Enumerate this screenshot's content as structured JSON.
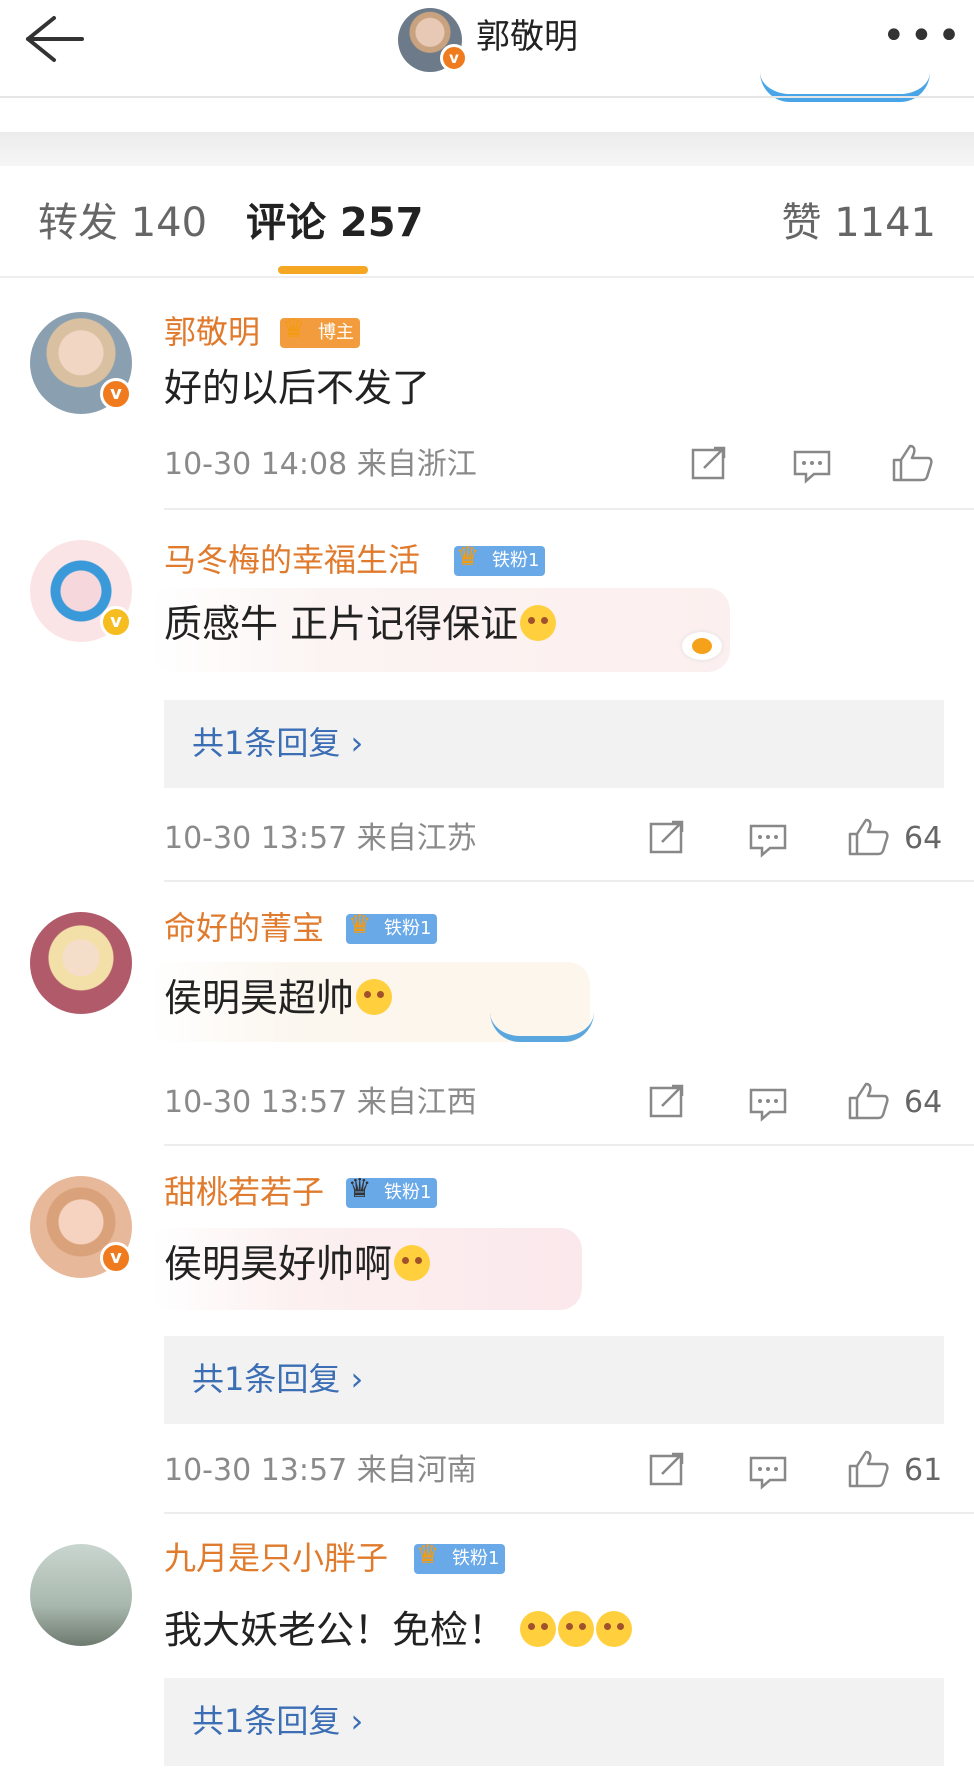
{
  "header": {
    "title": "郭敬明",
    "more_icon": "more-dots-icon",
    "back_icon": "back-arrow-icon"
  },
  "tabs": {
    "repost": "转发 140",
    "comments": "评论 257",
    "likes": "赞 1141",
    "active_color": "#f5a623"
  },
  "comments": [
    {
      "name": "郭敬明",
      "tag": "博主",
      "text": "好的以后不发了",
      "time": "10-30 14:08",
      "location": "来自浙江",
      "likes": ""
    },
    {
      "name": "马冬梅的幸福生活",
      "tag": "铁粉1",
      "text": "质感牛  正片记得保证",
      "reply": "共1条回复 ›",
      "time": "10-30 13:57",
      "location": "来自江苏",
      "likes": "64"
    },
    {
      "name": "命好的菁宝",
      "tag": "铁粉1",
      "text": "侯明昊超帅",
      "time": "10-30 13:57",
      "location": "来自江西",
      "likes": "64"
    },
    {
      "name": "甜桃若若子",
      "tag": "铁粉1",
      "text": "侯明昊好帅啊",
      "reply": "共1条回复 ›",
      "time": "10-30 13:57",
      "location": "来自河南",
      "likes": "61"
    },
    {
      "name": "九月是只小胖子",
      "tag": "铁粉1",
      "text": "我大妖老公！免检！",
      "reply": "共1条回复 ›"
    }
  ],
  "colors": {
    "name": "#e07a2c",
    "reply_link": "#3b6eb4",
    "meta": "#8a8a8a",
    "verify_orange": "#f07b1e",
    "verify_yellow": "#f5bd1f",
    "fan_tag": "#6aa9e8",
    "host_tag": "#f39c3d"
  }
}
